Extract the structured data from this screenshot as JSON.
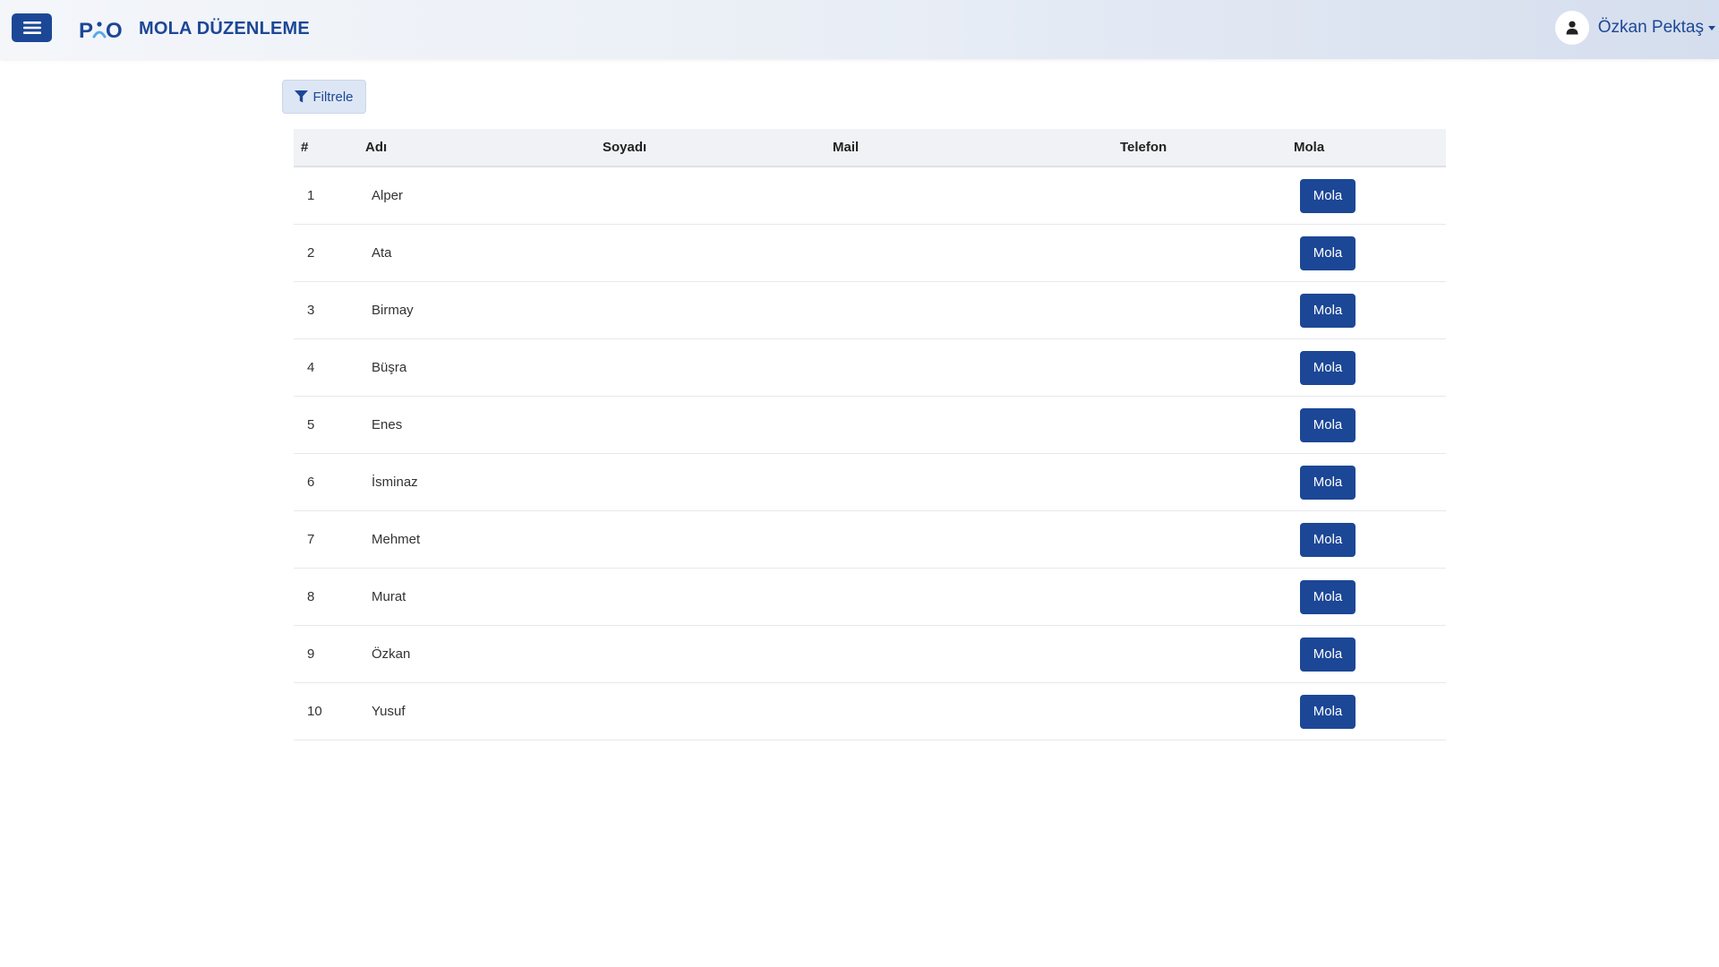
{
  "header": {
    "brand": "P•O",
    "title": "MOLA DÜZENLEME",
    "user_name": "Özkan Pektaş",
    "colors": {
      "primary": "#1c4796"
    },
    "icons": {
      "menu": "hamburger-icon",
      "user": "user-icon",
      "dropdown": "caret-down-icon"
    }
  },
  "toolbar": {
    "filter_label": "Filtrele",
    "filter_icon": "filter-icon"
  },
  "table": {
    "columns": [
      "#",
      "Adı",
      "Soyadı",
      "Mail",
      "Telefon",
      "Mola"
    ],
    "rows": [
      {
        "num": "1",
        "name": "Alper",
        "surname": "",
        "mail": "",
        "phone": "",
        "action": "Mola"
      },
      {
        "num": "2",
        "name": "Ata",
        "surname": "",
        "mail": "",
        "phone": "",
        "action": "Mola"
      },
      {
        "num": "3",
        "name": "Birmay",
        "surname": "",
        "mail": "",
        "phone": "",
        "action": "Mola"
      },
      {
        "num": "4",
        "name": "Büşra",
        "surname": "",
        "mail": "",
        "phone": "",
        "action": "Mola"
      },
      {
        "num": "5",
        "name": "Enes",
        "surname": "",
        "mail": "",
        "phone": "",
        "action": "Mola"
      },
      {
        "num": "6",
        "name": "İsminaz",
        "surname": "",
        "mail": "",
        "phone": "",
        "action": "Mola"
      },
      {
        "num": "7",
        "name": "Mehmet",
        "surname": "",
        "mail": "",
        "phone": "",
        "action": "Mola"
      },
      {
        "num": "8",
        "name": "Murat",
        "surname": "",
        "mail": "",
        "phone": "",
        "action": "Mola"
      },
      {
        "num": "9",
        "name": "Özkan",
        "surname": "",
        "mail": "",
        "phone": "",
        "action": "Mola"
      },
      {
        "num": "10",
        "name": "Yusuf",
        "surname": "",
        "mail": "",
        "phone": "",
        "action": "Mola"
      }
    ]
  }
}
